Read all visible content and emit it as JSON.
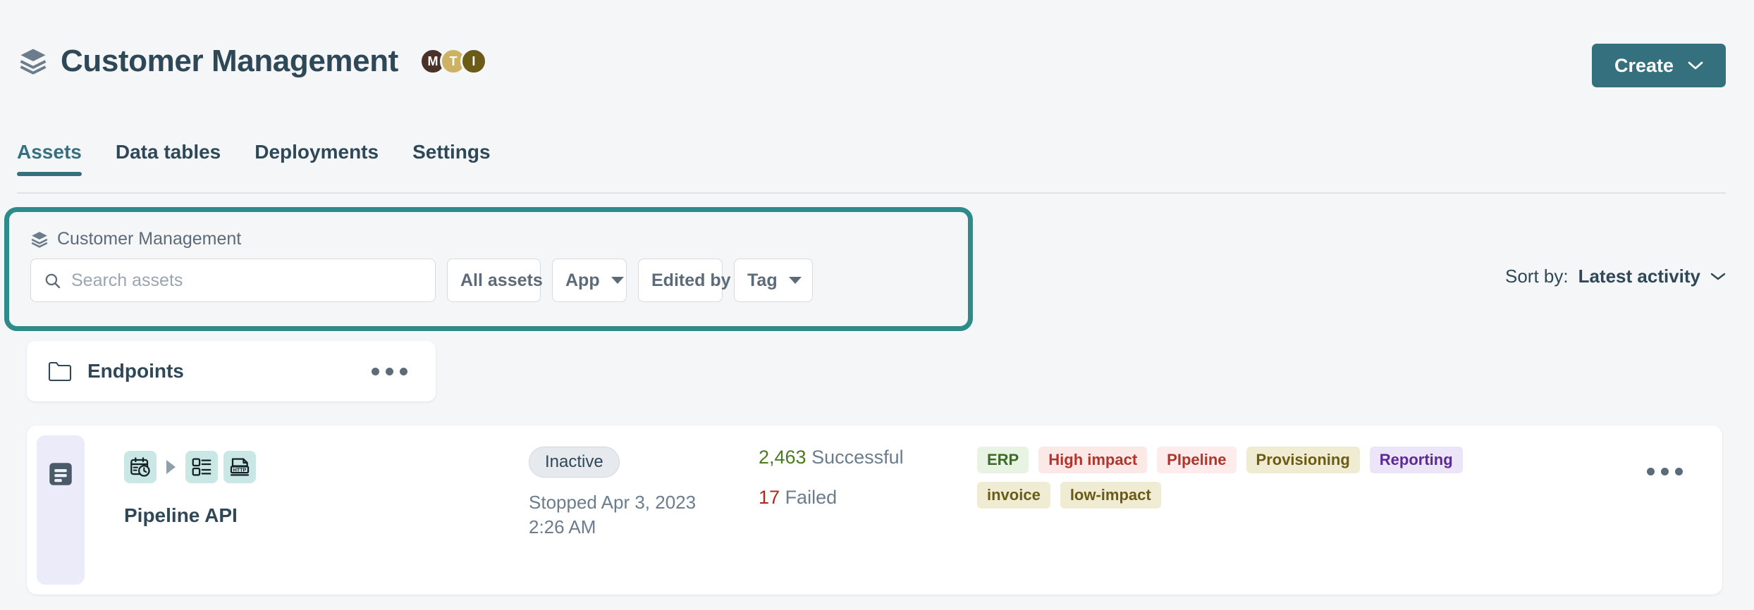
{
  "header": {
    "title": "Customer Management",
    "stack_icon": "layers-stack-icon",
    "avatars": [
      {
        "initial": "M",
        "color": "#4a3228"
      },
      {
        "initial": "T",
        "color": "#cdb263"
      },
      {
        "initial": "I",
        "color": "#6b5b16"
      }
    ],
    "create_button": {
      "label": "Create",
      "icon": "chevron-down-icon",
      "color": "#35707f"
    }
  },
  "tabs": [
    {
      "label": "Assets",
      "active": true
    },
    {
      "label": "Data tables",
      "active": false
    },
    {
      "label": "Deployments",
      "active": false
    },
    {
      "label": "Settings",
      "active": false
    }
  ],
  "filter_panel": {
    "highlight_color": "#2f8a8a",
    "context_label": "Customer Management",
    "context_icon": "layers-stack-icon",
    "search": {
      "placeholder": "Search assets",
      "value": "",
      "icon": "search-icon"
    },
    "dropdowns": [
      {
        "label": "All assets"
      },
      {
        "label": "App"
      },
      {
        "label": "Edited by"
      },
      {
        "label": "Tag"
      }
    ]
  },
  "sort": {
    "prefix": "Sort by:",
    "value": "Latest activity",
    "icon": "chevron-down-icon"
  },
  "folder": {
    "icon": "folder-icon",
    "name": "Endpoints",
    "menu_icon": "more-horizontal-icon"
  },
  "asset": {
    "left_icon": "document-lines-icon",
    "type_icons": [
      {
        "name": "calendar-clock-icon"
      },
      {
        "name": "arrow-right-icon"
      },
      {
        "name": "form-list-icon"
      },
      {
        "name": "http-file-icon"
      }
    ],
    "name": "Pipeline API",
    "status_badge": "Inactive",
    "stopped_text": "Stopped Apr 3, 2023 2:26 AM",
    "runs": {
      "successful": {
        "count": "2,463",
        "label": "Successful",
        "color": "#4b7a20"
      },
      "failed": {
        "count": "17",
        "label": "Failed",
        "color": "#a82b1e"
      }
    },
    "tags": [
      {
        "label": "ERP",
        "bg": "#e8f3e3",
        "fg": "#3f6b2a"
      },
      {
        "label": "High impact",
        "bg": "#fbe9e7",
        "fg": "#b2342a"
      },
      {
        "label": "PIpeline",
        "bg": "#fdeceb",
        "fg": "#b2342a"
      },
      {
        "label": "Provisioning",
        "bg": "#f0ecd3",
        "fg": "#6b5b16"
      },
      {
        "label": "Reporting",
        "bg": "#ece4f7",
        "fg": "#5b2a96"
      },
      {
        "label": "invoice",
        "bg": "#f0ecd3",
        "fg": "#6b5b16"
      },
      {
        "label": "low-impact",
        "bg": "#f0ecd3",
        "fg": "#6b5b16"
      }
    ],
    "menu_icon": "more-horizontal-icon"
  }
}
